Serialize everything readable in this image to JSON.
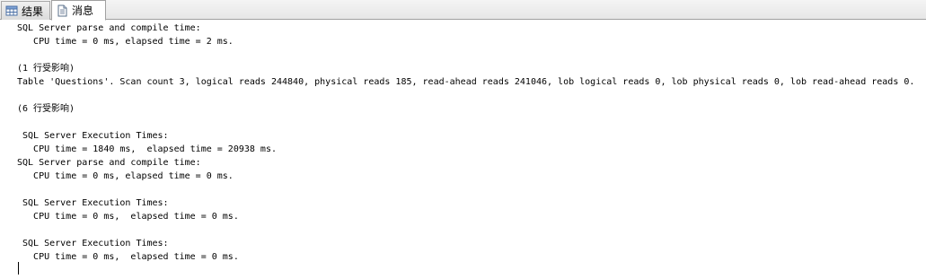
{
  "tabs": [
    {
      "label": "结果",
      "icon": "grid-icon"
    },
    {
      "label": "消息",
      "icon": "document-icon"
    }
  ],
  "messages": [
    "SQL Server parse and compile time:",
    "   CPU time = 0 ms, elapsed time = 2 ms.",
    "",
    "(1 行受影响)",
    "Table 'Questions'. Scan count 3, logical reads 244840, physical reads 185, read-ahead reads 241046, lob logical reads 0, lob physical reads 0, lob read-ahead reads 0.",
    "",
    "(6 行受影响)",
    "",
    " SQL Server Execution Times:",
    "   CPU time = 1840 ms,  elapsed time = 20938 ms.",
    "SQL Server parse and compile time:",
    "   CPU time = 0 ms, elapsed time = 0 ms.",
    "",
    " SQL Server Execution Times:",
    "   CPU time = 0 ms,  elapsed time = 0 ms.",
    "",
    " SQL Server Execution Times:",
    "   CPU time = 0 ms,  elapsed time = 0 ms."
  ]
}
